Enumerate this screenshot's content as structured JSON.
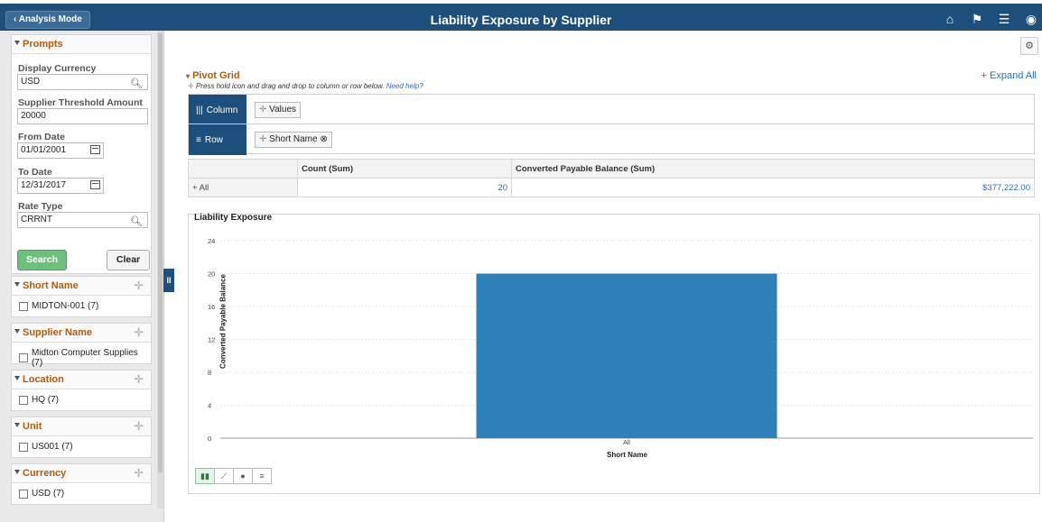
{
  "header": {
    "back_label": "Analysis Mode",
    "title": "Liability Exposure by Supplier"
  },
  "prompts": {
    "title": "Prompts",
    "display_currency_label": "Display Currency",
    "display_currency_value": "USD",
    "threshold_label": "Supplier Threshold Amount",
    "threshold_value": "20000",
    "from_date_label": "From Date",
    "from_date_value": "01/01/2001",
    "to_date_label": "To Date",
    "to_date_value": "12/31/2017",
    "rate_type_label": "Rate Type",
    "rate_type_value": "CRRNT",
    "search_label": "Search",
    "clear_label": "Clear"
  },
  "facets": [
    {
      "title": "Short Name",
      "item": "MIDTON-001 (7)"
    },
    {
      "title": "Supplier Name",
      "item": "Midton Computer Supplies (7)"
    },
    {
      "title": "Location",
      "item": "HQ (7)"
    },
    {
      "title": "Unit",
      "item": "US001 (7)"
    },
    {
      "title": "Currency",
      "item": "USD (7)"
    }
  ],
  "pivot": {
    "title": "Pivot Grid",
    "expand_all": "+ Expand All",
    "hint": "Press hold icon and drag and drop to column or row below.",
    "need_help": "Need help?",
    "column_label": "Column",
    "column_chip": "Values",
    "row_label": "Row",
    "row_chip": "Short Name",
    "headers": [
      "",
      "Count (Sum)",
      "Converted Payable Balance (Sum)"
    ],
    "rows": [
      {
        "label": "+ All",
        "count": "20",
        "balance": "$377,222.00"
      }
    ]
  },
  "chart_data": {
    "type": "bar",
    "title": "Liability Exposure",
    "categories": [
      "All"
    ],
    "values": [
      20
    ],
    "xlabel": "Short Name",
    "ylabel": "Converted Payable Balance",
    "ylim": [
      0,
      24
    ],
    "yticks": [
      "0",
      "4",
      "8",
      "12",
      "16",
      "20",
      "24"
    ],
    "bar_color": "#2f7fb8",
    "grid": true
  }
}
